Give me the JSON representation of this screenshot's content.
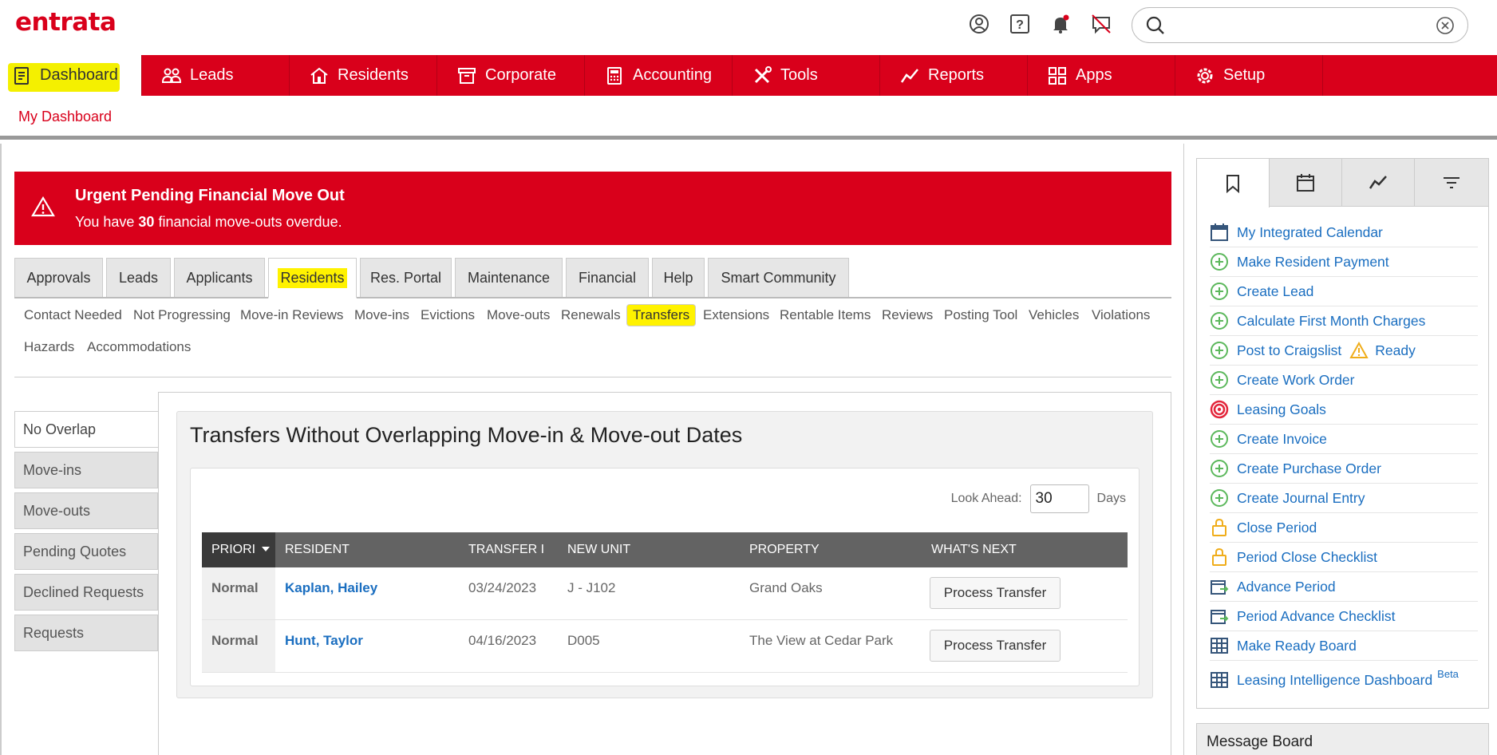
{
  "logo": "entrata",
  "colors": {
    "brand": "#d9001b",
    "highlight": "#fff200",
    "link": "#1a6ec0"
  },
  "search": {
    "value": "",
    "placeholder": ""
  },
  "mainnav": {
    "items": [
      {
        "label": "Dashboard",
        "icon": "dashboard-icon"
      },
      {
        "label": "Leads",
        "icon": "people-icon"
      },
      {
        "label": "Residents",
        "icon": "home-icon"
      },
      {
        "label": "Corporate",
        "icon": "archive-icon"
      },
      {
        "label": "Accounting",
        "icon": "calculator-icon"
      },
      {
        "label": "Tools",
        "icon": "tools-icon"
      },
      {
        "label": "Reports",
        "icon": "trend-icon"
      },
      {
        "label": "Apps",
        "icon": "apps-icon"
      },
      {
        "label": "Setup",
        "icon": "gear-icon"
      }
    ]
  },
  "subnav": {
    "link": "My Dashboard"
  },
  "alert": {
    "title": "Urgent Pending Financial Move Out",
    "text_before": "You have ",
    "count": "30",
    "text_after": " financial move-outs overdue."
  },
  "tabs": [
    "Approvals",
    "Leads",
    "Applicants",
    "Residents",
    "Res. Portal",
    "Maintenance",
    "Financial",
    "Help",
    "Smart Community"
  ],
  "subtabs": [
    "Contact Needed",
    "Not Progressing",
    "Move-in Reviews",
    "Move-ins",
    "Evictions",
    "Move-outs",
    "Renewals",
    "Transfers",
    "Extensions",
    "Rentable Items",
    "Reviews",
    "Posting Tool",
    "Vehicles",
    "Violations",
    "Hazards",
    "Accommodations"
  ],
  "sidemenu": [
    "No Overlap",
    "Move-ins",
    "Move-outs",
    "Pending Quotes",
    "Declined Requests",
    "Requests"
  ],
  "panel": {
    "title": "Transfers Without Overlapping Move-in & Move-out Dates",
    "lookahead_label": "Look Ahead:",
    "lookahead_value": "30",
    "lookahead_unit": "Days"
  },
  "table": {
    "headers": [
      "PRIORI",
      "RESIDENT",
      "TRANSFER I",
      "NEW UNIT",
      "PROPERTY",
      "WHAT'S NEXT"
    ],
    "rows": [
      {
        "priority": "Normal",
        "resident": "Kaplan, Hailey",
        "date": "03/24/2023",
        "unit": "J - J102",
        "property": "Grand Oaks",
        "action": "Process Transfer"
      },
      {
        "priority": "Normal",
        "resident": "Hunt, Taylor",
        "date": "04/16/2023",
        "unit": "D005",
        "property": "The View at Cedar Park",
        "action": "Process Transfer"
      }
    ]
  },
  "quicklinks": [
    {
      "label": "My Integrated Calendar",
      "icon": "calendar-icon"
    },
    {
      "label": "Make Resident Payment",
      "icon": "plus-circle-icon"
    },
    {
      "label": "Create Lead",
      "icon": "plus-circle-icon"
    },
    {
      "label": "Calculate First Month Charges",
      "icon": "plus-circle-icon"
    },
    {
      "label": "Post to Craigslist",
      "icon": "plus-circle-icon",
      "extra": "Ready"
    },
    {
      "label": "Create Work Order",
      "icon": "plus-circle-icon"
    },
    {
      "label": "Leasing Goals",
      "icon": "target-icon"
    },
    {
      "label": "Create Invoice",
      "icon": "plus-circle-icon"
    },
    {
      "label": "Create Purchase Order",
      "icon": "plus-circle-icon"
    },
    {
      "label": "Create Journal Entry",
      "icon": "plus-circle-icon"
    },
    {
      "label": "Close Period",
      "icon": "lock-icon"
    },
    {
      "label": "Period Close Checklist",
      "icon": "lock-icon"
    },
    {
      "label": "Advance Period",
      "icon": "calendar-arrow-icon"
    },
    {
      "label": "Period Advance Checklist",
      "icon": "calendar-arrow-icon"
    },
    {
      "label": "Make Ready Board",
      "icon": "grid-icon"
    },
    {
      "label": "Leasing Intelligence Dashboard",
      "icon": "grid-icon",
      "badge": "Beta"
    }
  ],
  "messageboard": "Message Board"
}
